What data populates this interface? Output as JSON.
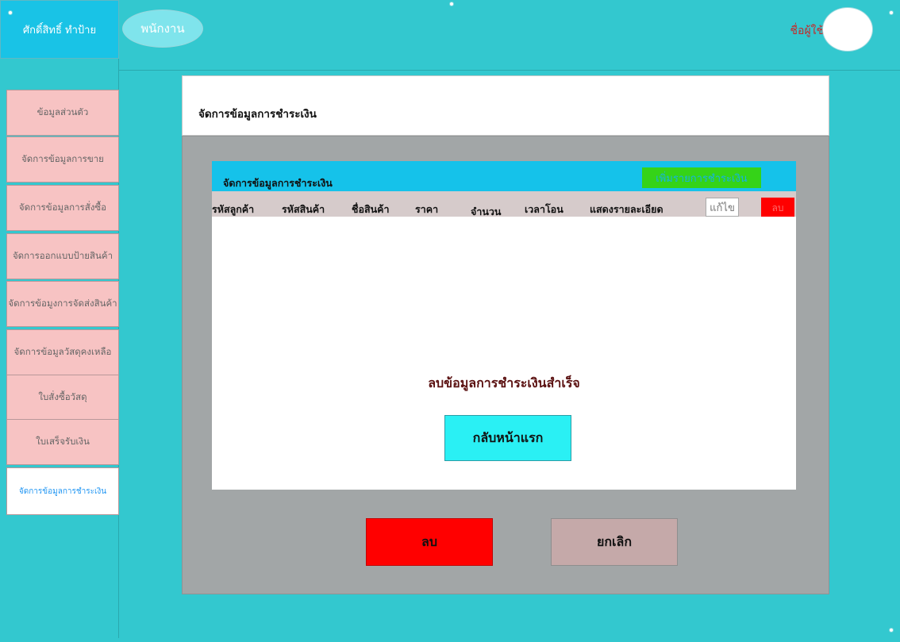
{
  "header": {
    "shop_name": "ศักดิ์สิทธิ์ ทำป้าย",
    "role": "พนักงาน",
    "username": "ชื่อผู้ใช้"
  },
  "sidebar": {
    "items": [
      {
        "label": "ข้อมูลส่วนตัว"
      },
      {
        "label": "จัดการข้อมูลการขาย"
      },
      {
        "label": "จัดการข้อมูลการสั่งซื้อ"
      },
      {
        "label": "จัดการออกแบบป้ายสินค้า"
      },
      {
        "label": "จัดการข้อมูงการจัดส่งสินค้า"
      },
      {
        "label": "จัดการข้อมูลวัสดุคงเหลือ"
      },
      {
        "label": "ใบสั่งซื้อวัสดุ"
      },
      {
        "label": "ใบเสร็จรับเงิน"
      },
      {
        "label": "จัดการข้อมูลการชำระเงิน"
      }
    ]
  },
  "main": {
    "page_title": "จัดการข้อมูลการชำระเงิน",
    "table": {
      "title": "จัดการข้อมูลการชำระเงิน",
      "add_label": "เพิ่มรายการชำระเงิน",
      "columns": [
        "รหัสลูกค้า",
        "รหัสสินค้า",
        "ชื่อสินค้า",
        "ราคา",
        "จำนวน",
        "เวลาโอน",
        "แสดงรายละเอียด"
      ],
      "edit_label": "แก้ไข",
      "delete_label": "ลบ"
    },
    "success_message": "ลบข้อมูลการชำระเงินสำเร็จ",
    "home_button": "กลับหน้าแรก",
    "delete_button": "ลบ",
    "cancel_button": "ยกเลิก"
  },
  "colors": {
    "background": "#33c8cf",
    "table_header": "#15c2ea",
    "add_button": "#35d318",
    "delete": "#ff0000",
    "home_button": "#2af0f4"
  }
}
